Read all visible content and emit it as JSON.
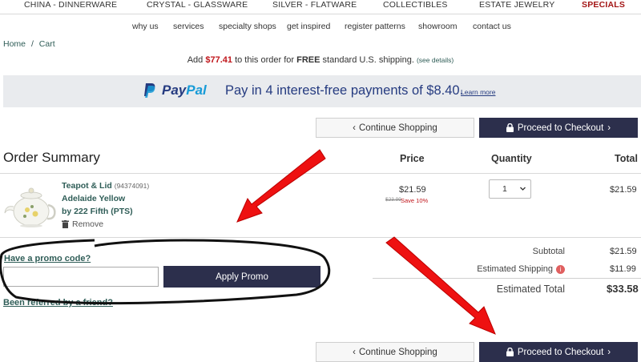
{
  "topnav": [
    "CHINA - DINNERWARE",
    "CRYSTAL - GLASSWARE",
    "SILVER - FLATWARE",
    "COLLECTIBLES",
    "ESTATE JEWELRY",
    "SPECIALS"
  ],
  "subnav": [
    "why us",
    "services",
    "specialty shops",
    "get inspired",
    "register patterns",
    "showroom",
    "contact us"
  ],
  "breadcrumb": {
    "home": "Home",
    "separator": "/",
    "current": "Cart"
  },
  "shipping_message": {
    "prefix": "Add",
    "amount": "$77.41",
    "middle": "to this order for",
    "free": "FREE",
    "suffix": "standard U.S. shipping.",
    "details": "(see details)"
  },
  "paypal": {
    "logo_pay": "Pay",
    "logo_pal": "Pal",
    "message": "Pay in 4 interest-free payments of $8.40.",
    "learn_more": "Learn more"
  },
  "buttons": {
    "continue": "Continue Shopping",
    "checkout": "Proceed to Checkout",
    "apply_promo": "Apply Promo"
  },
  "order_summary": {
    "title": "Order Summary",
    "columns": {
      "price": "Price",
      "quantity": "Quantity",
      "total": "Total"
    },
    "item": {
      "name": "Teapot & Lid",
      "sku": "(94374091)",
      "pattern": "Adelaide Yellow",
      "maker": "by 222 Fifth (PTS)",
      "remove": "Remove",
      "price": "$21.59",
      "original_price": "$23.99",
      "save": "Save 10%",
      "quantity": "1",
      "total": "$21.59"
    }
  },
  "totals": {
    "subtotal_label": "Subtotal",
    "subtotal": "$21.59",
    "shipping_label": "Estimated Shipping",
    "shipping": "$11.99",
    "estimated_total_label": "Estimated Total",
    "estimated_total": "$33.58"
  },
  "promo": {
    "link": "Have a promo code?",
    "input_value": "",
    "referred": "Been referred by a friend?"
  },
  "colors": {
    "accent_dark": "#2c2f4c",
    "link_green": "#2f5d57",
    "sale_red": "#c0161b",
    "annotation_red": "#ee1111"
  }
}
